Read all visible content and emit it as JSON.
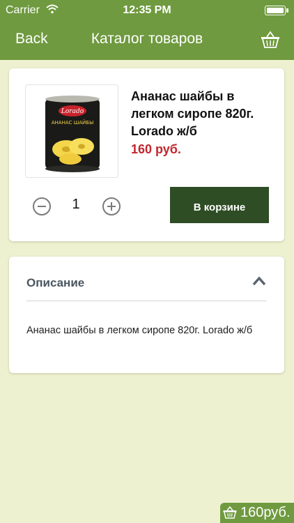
{
  "status_bar": {
    "carrier": "Carrier",
    "time": "12:35 PM"
  },
  "nav": {
    "back_label": "Back",
    "title": "Каталог товаров",
    "cart_icon": "basket-icon"
  },
  "product": {
    "name": "Ананас шайбы в легком сиропе 820г. Lorado ж/б",
    "price": "160 руб.",
    "image_icon": "product-can-image",
    "quantity": "1",
    "add_button_label": "В корзине",
    "can_brand": "Lorado",
    "can_label": "АНАНАС ШАЙБЫ"
  },
  "description": {
    "header": "Описание",
    "text": "Ананас шайбы в легком сиропе 820г. Lorado ж/б"
  },
  "cart_total": {
    "amount": "160руб."
  },
  "colors": {
    "nav_bg": "#6f9a3f",
    "page_bg": "#eef1cf",
    "price": "#c0272d",
    "button_bg": "#2f4d25"
  }
}
